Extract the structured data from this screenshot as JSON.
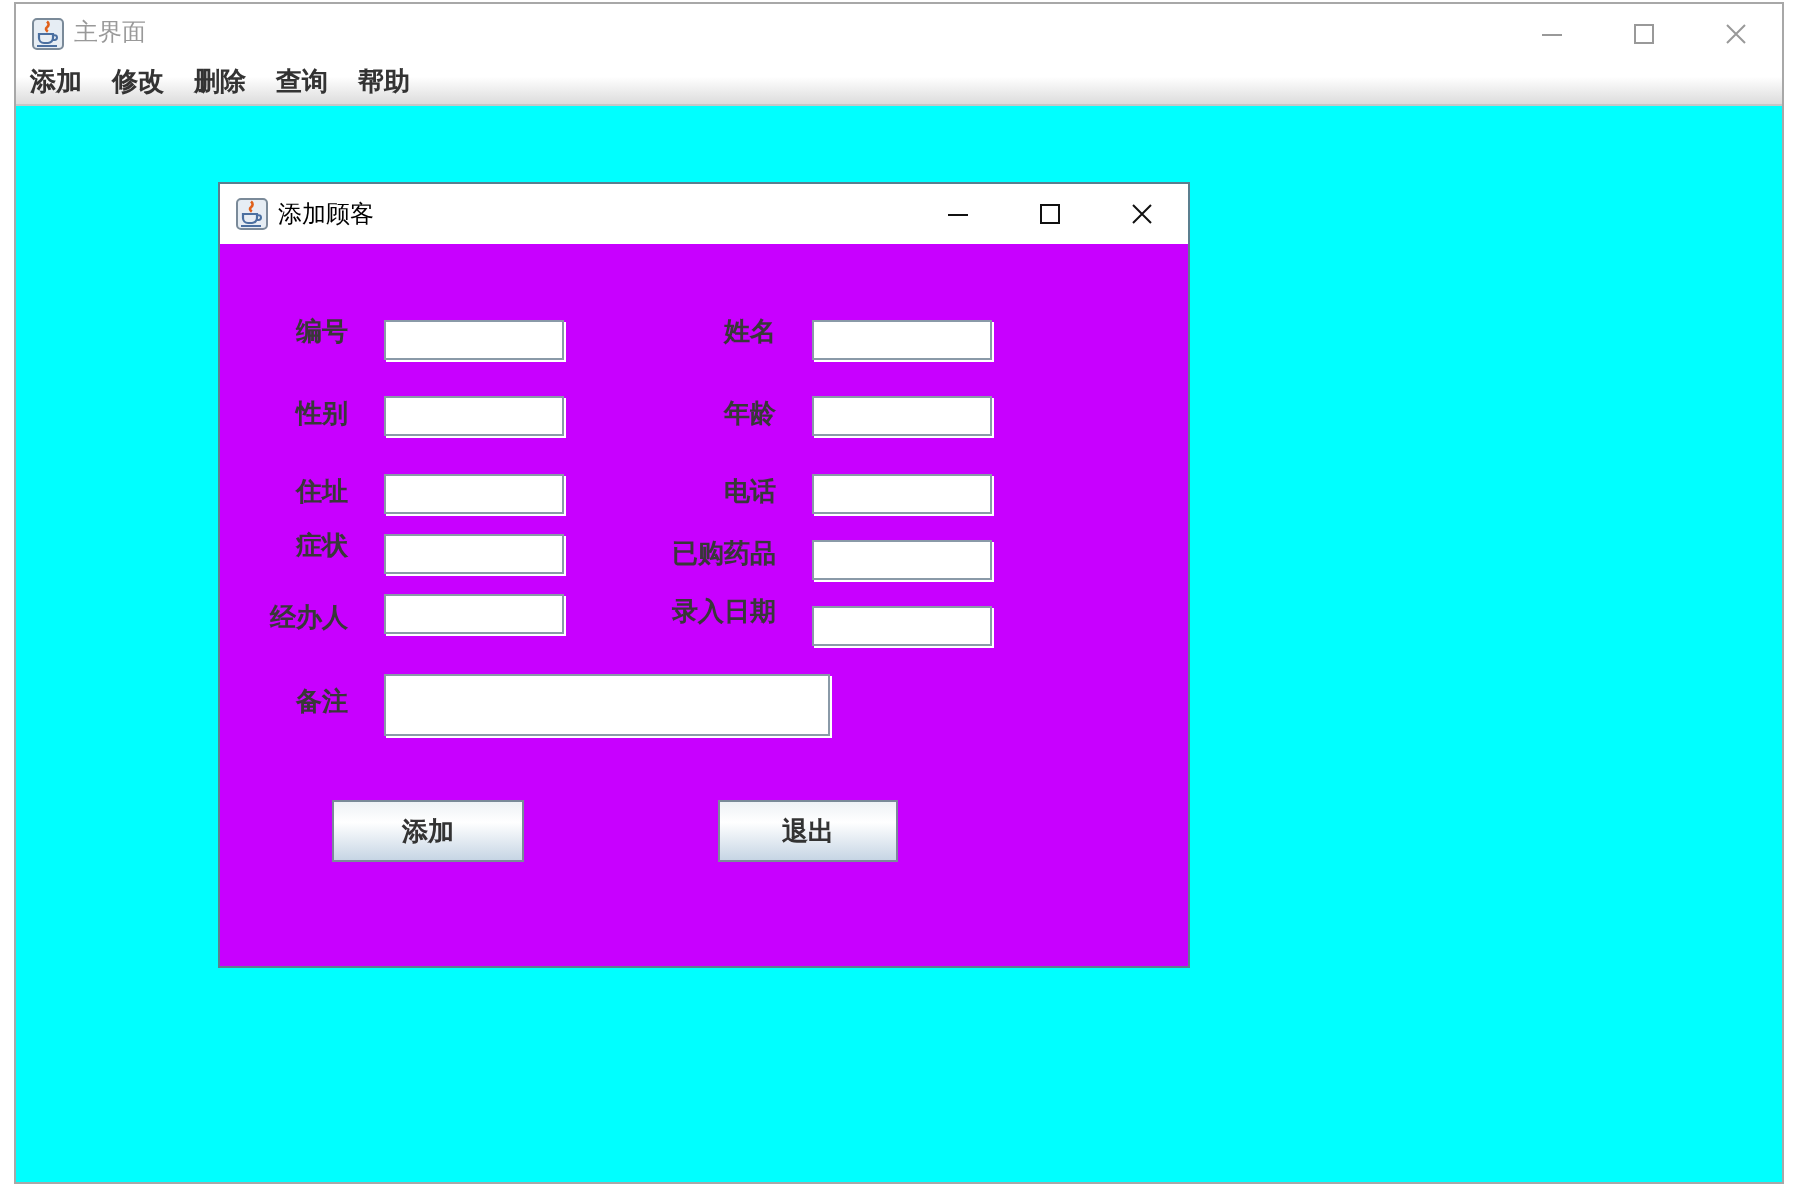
{
  "main_window": {
    "title": "主界面",
    "menu": [
      "添加",
      "修改",
      "删除",
      "查询",
      "帮助"
    ]
  },
  "dialog": {
    "title": "添加顾客",
    "fields": [
      {
        "label": "编号",
        "kind": "short"
      },
      {
        "label": "姓名",
        "kind": "short"
      },
      {
        "label": "性别",
        "kind": "short"
      },
      {
        "label": "年龄",
        "kind": "short"
      },
      {
        "label": "住址",
        "kind": "short"
      },
      {
        "label": "电话",
        "kind": "short"
      },
      {
        "label": "症状",
        "kind": "short"
      },
      {
        "label": "已购药品",
        "kind": "short"
      },
      {
        "label": "经办人",
        "kind": "short"
      },
      {
        "label": "录入日期",
        "kind": "short"
      },
      {
        "label": "备注",
        "kind": "wide"
      }
    ],
    "buttons": [
      "添加",
      "退出"
    ]
  }
}
